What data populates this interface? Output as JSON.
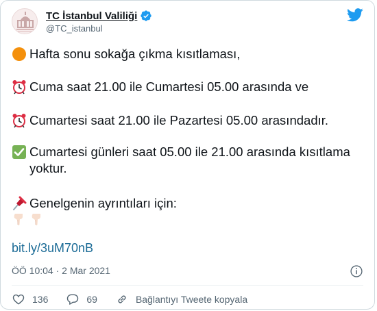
{
  "tweet": {
    "author": {
      "display_name": "TC İstanbul Valiliği",
      "handle": "@TC_istanbul"
    },
    "lines": {
      "l1": "Hafta sonu sokağa çıkma kısıtlaması,",
      "l2": "Cuma saat 21.00 ile Cumartesi 05.00 arasında ve",
      "l3": "Cumartesi saat 21.00 ile Pazartesi 05.00 arasındadır.",
      "l4": "Cumartesi günleri saat 05.00 ile 21.00 arasında kısıtlama yoktur.",
      "l5": "Genelgenin ayrıntıları için:",
      "link": "bit.ly/3uM70nB"
    },
    "timestamp": "ÖÖ 10:04 · 2 Mar 2021",
    "actions": {
      "likes": "136",
      "replies": "69",
      "copy_link": "Bağlantıyı Tweete kopyala"
    }
  },
  "icons": {
    "avatar": "istanbul-governorship-logo",
    "verified": "verified-badge-icon",
    "brand": "twitter-bird-icon",
    "emoji_1": "orange-circle-emoji",
    "emoji_2": "alarm-clock-emoji",
    "emoji_3": "alarm-clock-emoji",
    "emoji_4": "check-mark-button-emoji",
    "emoji_5": "pushpin-emoji",
    "emoji_6": "backhand-index-pointing-down-emoji"
  },
  "colors": {
    "twitter_blue": "#1d9bf0",
    "link": "#1b6b96",
    "secondary_text": "#536471",
    "orange": "#f4900c",
    "check_green": "#77b255"
  }
}
